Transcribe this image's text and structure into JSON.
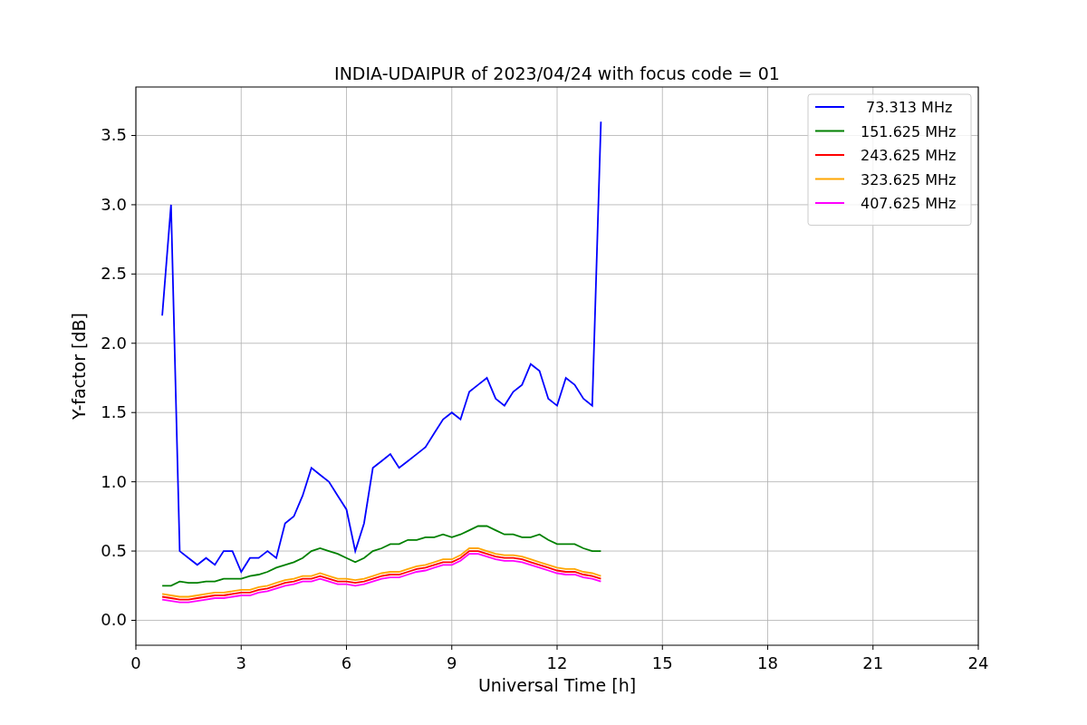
{
  "figure": {
    "chart_data": {
      "type": "line",
      "title": "INDIA-UDAIPUR of 2023/04/24 with focus code = 01",
      "xlabel": "Universal Time [h]",
      "ylabel": "Y-factor [dB]",
      "x": [
        0.75,
        1.0,
        1.25,
        1.5,
        1.75,
        2.0,
        2.25,
        2.5,
        2.75,
        3.0,
        3.25,
        3.5,
        3.75,
        4.0,
        4.25,
        4.5,
        4.75,
        5.0,
        5.25,
        5.5,
        5.75,
        6.0,
        6.25,
        6.5,
        6.75,
        7.0,
        7.25,
        7.5,
        7.75,
        8.0,
        8.25,
        8.5,
        8.75,
        9.0,
        9.25,
        9.5,
        9.75,
        10.0,
        10.25,
        10.5,
        10.75,
        11.0,
        11.25,
        11.5,
        11.75,
        12.0,
        12.25,
        12.5,
        12.75,
        13.0,
        13.25
      ],
      "series": [
        {
          "name": "73.313 MHz",
          "color": "#0000ff",
          "values": [
            2.2,
            3.0,
            0.5,
            0.45,
            0.4,
            0.45,
            0.4,
            0.5,
            0.5,
            0.35,
            0.45,
            0.45,
            0.5,
            0.45,
            0.7,
            0.75,
            0.9,
            1.1,
            1.05,
            1.0,
            0.9,
            0.8,
            0.5,
            0.7,
            1.1,
            1.15,
            1.2,
            1.1,
            1.15,
            1.2,
            1.25,
            1.35,
            1.45,
            1.5,
            1.45,
            1.65,
            1.7,
            1.75,
            1.6,
            1.55,
            1.65,
            1.7,
            1.85,
            1.8,
            1.6,
            1.55,
            1.75,
            1.7,
            1.6,
            1.55,
            3.6
          ]
        },
        {
          "name": "151.625 MHz",
          "color": "#008000",
          "values": [
            0.25,
            0.25,
            0.28,
            0.27,
            0.27,
            0.28,
            0.28,
            0.3,
            0.3,
            0.3,
            0.32,
            0.33,
            0.35,
            0.38,
            0.4,
            0.42,
            0.45,
            0.5,
            0.52,
            0.5,
            0.48,
            0.45,
            0.42,
            0.45,
            0.5,
            0.52,
            0.55,
            0.55,
            0.58,
            0.58,
            0.6,
            0.6,
            0.62,
            0.6,
            0.62,
            0.65,
            0.68,
            0.68,
            0.65,
            0.62,
            0.62,
            0.6,
            0.6,
            0.62,
            0.58,
            0.55,
            0.55,
            0.55,
            0.52,
            0.5,
            0.5
          ]
        },
        {
          "name": "243.625 MHz",
          "color": "#ff0000",
          "values": [
            0.17,
            0.16,
            0.15,
            0.15,
            0.16,
            0.17,
            0.18,
            0.18,
            0.19,
            0.2,
            0.2,
            0.22,
            0.23,
            0.25,
            0.27,
            0.28,
            0.3,
            0.3,
            0.32,
            0.3,
            0.28,
            0.28,
            0.27,
            0.28,
            0.3,
            0.32,
            0.33,
            0.33,
            0.35,
            0.37,
            0.38,
            0.4,
            0.42,
            0.42,
            0.45,
            0.5,
            0.5,
            0.48,
            0.46,
            0.45,
            0.45,
            0.44,
            0.42,
            0.4,
            0.38,
            0.36,
            0.35,
            0.35,
            0.33,
            0.32,
            0.3
          ]
        },
        {
          "name": "323.625 MHz",
          "color": "#ffa500",
          "values": [
            0.19,
            0.18,
            0.17,
            0.17,
            0.18,
            0.19,
            0.2,
            0.2,
            0.21,
            0.22,
            0.22,
            0.24,
            0.25,
            0.27,
            0.29,
            0.3,
            0.32,
            0.32,
            0.34,
            0.32,
            0.3,
            0.3,
            0.29,
            0.3,
            0.32,
            0.34,
            0.35,
            0.35,
            0.37,
            0.39,
            0.4,
            0.42,
            0.44,
            0.44,
            0.47,
            0.52,
            0.52,
            0.5,
            0.48,
            0.47,
            0.47,
            0.46,
            0.44,
            0.42,
            0.4,
            0.38,
            0.37,
            0.37,
            0.35,
            0.34,
            0.32
          ]
        },
        {
          "name": "407.625 MHz",
          "color": "#ff00ff",
          "values": [
            0.15,
            0.14,
            0.13,
            0.13,
            0.14,
            0.15,
            0.16,
            0.16,
            0.17,
            0.18,
            0.18,
            0.2,
            0.21,
            0.23,
            0.25,
            0.26,
            0.28,
            0.28,
            0.3,
            0.28,
            0.26,
            0.26,
            0.25,
            0.26,
            0.28,
            0.3,
            0.31,
            0.31,
            0.33,
            0.35,
            0.36,
            0.38,
            0.4,
            0.4,
            0.43,
            0.48,
            0.48,
            0.46,
            0.44,
            0.43,
            0.43,
            0.42,
            0.4,
            0.38,
            0.36,
            0.34,
            0.33,
            0.33,
            0.31,
            0.3,
            0.28
          ]
        }
      ],
      "grid": true,
      "legend": true,
      "xlim": [
        0,
        24
      ],
      "ylim": [
        -0.18,
        3.85
      ],
      "xticks": [
        0,
        3,
        6,
        9,
        12,
        15,
        18,
        21,
        24
      ],
      "yticks": [
        {
          "value": 0,
          "label": "0.0"
        },
        {
          "value": 0.5,
          "label": "0.5"
        },
        {
          "value": 1,
          "label": "1.0"
        },
        {
          "value": 1.5,
          "label": "1.5"
        },
        {
          "value": 2,
          "label": "2.0"
        },
        {
          "value": 2.5,
          "label": "2.5"
        },
        {
          "value": 3,
          "label": "3.0"
        },
        {
          "value": 3.5,
          "label": "3.5"
        }
      ]
    }
  }
}
